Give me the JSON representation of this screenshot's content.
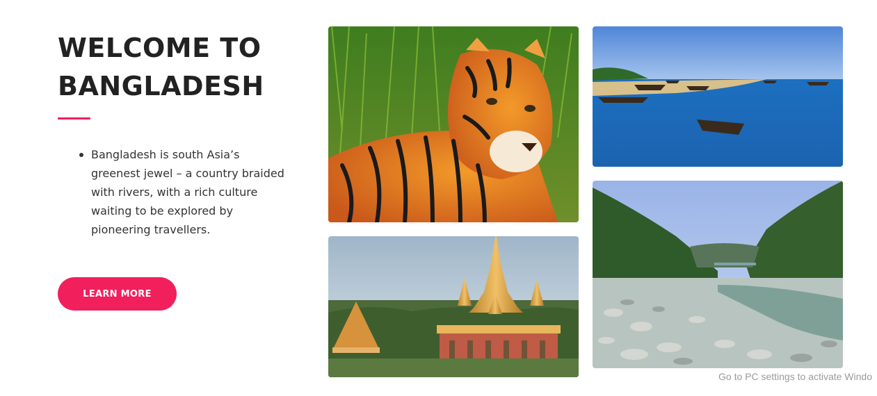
{
  "hero": {
    "title_line1": "WELCOME TO",
    "title_line2": "BANGLADESH",
    "accent_color": "#f21f5d",
    "intro_items": [
      "Bangladesh is south Asia’s greenest jewel – a country braided with rivers, with a rich culture waiting to be explored by pioneering travellers."
    ],
    "cta_label": "LEARN MORE"
  },
  "gallery": {
    "images": [
      {
        "subject": "bengal-tiger"
      },
      {
        "subject": "beach-with-boats"
      },
      {
        "subject": "golden-pagoda"
      },
      {
        "subject": "rocky-river-valley"
      }
    ]
  },
  "system": {
    "watermark": "Go to PC settings to activate Windo"
  }
}
